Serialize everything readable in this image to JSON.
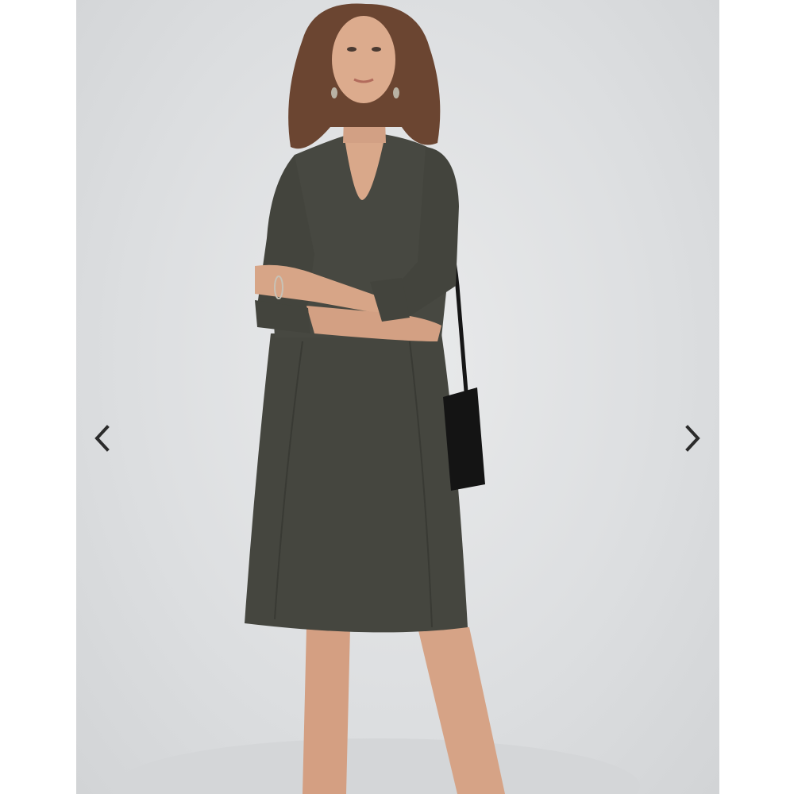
{
  "gallery": {
    "prev_icon": "chevron-left-icon",
    "next_icon": "chevron-right-icon",
    "image_subject": "woman-in-dark-olive-long-sleeve-a-line-dress"
  },
  "colors": {
    "background": "#dcdee0",
    "dress": "#45463f",
    "dress_shadow": "#3a3b35",
    "skin": "#d9a88a",
    "hair": "#6b4531",
    "bag": "#141414",
    "arrow": "#2b2b2b"
  }
}
